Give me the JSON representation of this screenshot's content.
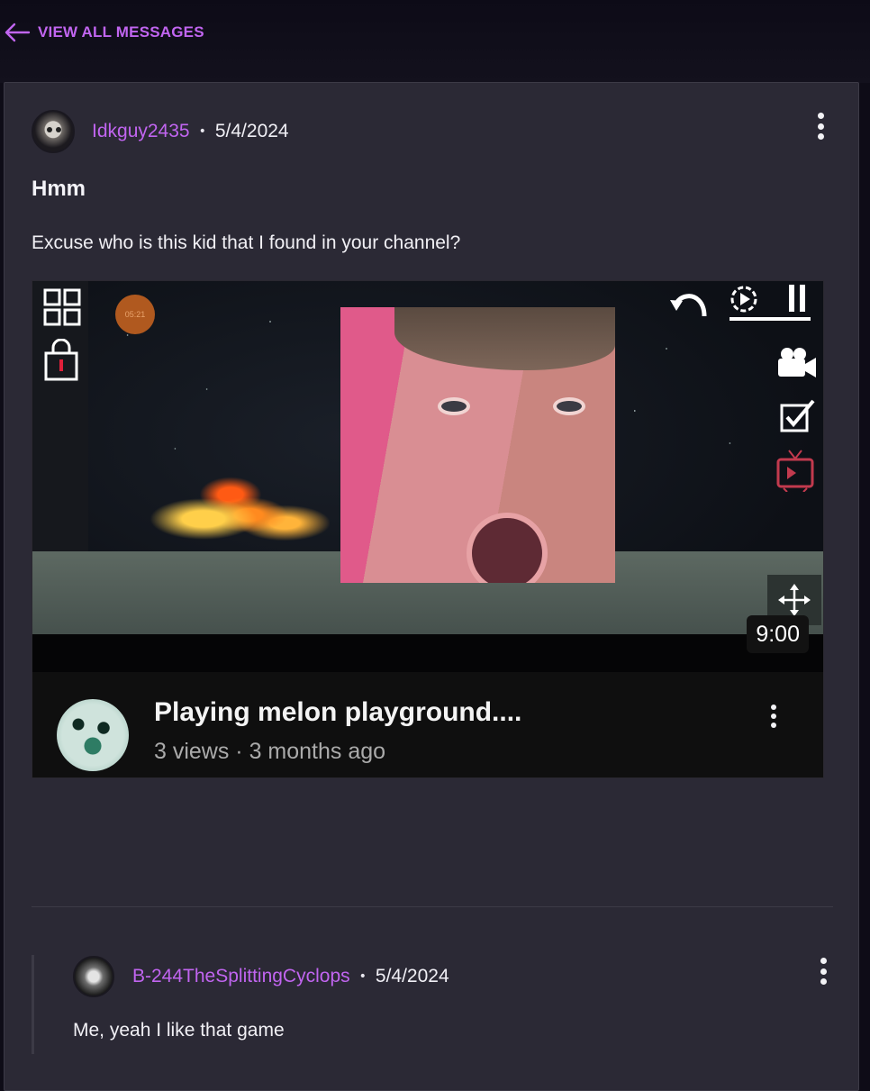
{
  "nav": {
    "back_label": "VIEW ALL MESSAGES"
  },
  "post": {
    "author": "Idkguy2435",
    "separator": "•",
    "date": "5/4/2024",
    "title": "Hmm",
    "body": "Excuse who is this kid that I found in your channel?"
  },
  "embed": {
    "timer_label": "05:21",
    "duration": "9:00",
    "video_title": "Playing melon playground....",
    "video_meta": "3 views · 3 months ago",
    "icons": [
      "grid-icon",
      "lock-icon",
      "undo-icon",
      "record-icon",
      "pause-icon",
      "camera-icon",
      "checkbox-icon",
      "tv-icon",
      "move-icon"
    ]
  },
  "reply": {
    "author": "B-244TheSplittingCyclops",
    "separator": "•",
    "date": "5/4/2024",
    "body": "Me, yeah I like that game"
  },
  "colors": {
    "accent": "#c165f0",
    "card_bg": "#2b2935",
    "page_bg": "#0e0c17"
  }
}
